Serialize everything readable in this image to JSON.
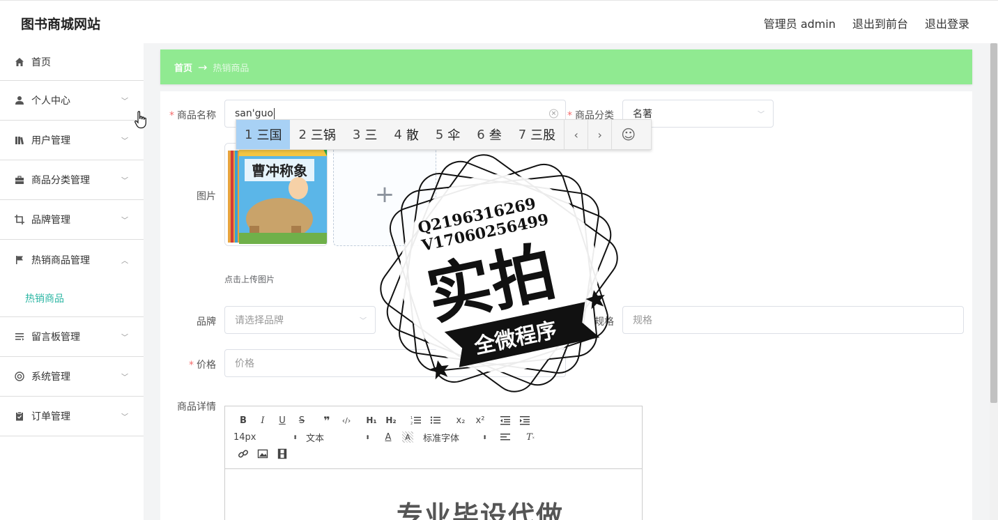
{
  "header": {
    "site_title": "图书商城网站",
    "admin_label": "管理员 admin",
    "to_front": "退出到前台",
    "logout": "退出登录"
  },
  "sidebar": {
    "items": [
      {
        "label": "首页",
        "icon": "home-icon"
      },
      {
        "label": "个人中心",
        "icon": "user-icon"
      },
      {
        "label": "用户管理",
        "icon": "books-icon"
      },
      {
        "label": "商品分类管理",
        "icon": "briefcase-icon"
      },
      {
        "label": "品牌管理",
        "icon": "crop-icon"
      },
      {
        "label": "热销商品管理",
        "icon": "flag-icon"
      },
      {
        "label": "留言板管理",
        "icon": "list-icon"
      },
      {
        "label": "系统管理",
        "icon": "lifebuoy-icon"
      },
      {
        "label": "订单管理",
        "icon": "clipboard-icon"
      }
    ],
    "submenu_active": "热销商品"
  },
  "breadcrumb": {
    "home": "首页",
    "arrow": "→",
    "current": "热销商品"
  },
  "form": {
    "name_label": "商品名称",
    "name_value": "san'guo",
    "category_label": "商品分类",
    "category_value": "名著",
    "image_label": "图片",
    "upload_tip": "点击上传图片",
    "upload_plus": "+",
    "brand_label": "品牌",
    "brand_placeholder": "请选择品牌",
    "spec_label": "规格",
    "spec_placeholder": "规格",
    "price_label": "价格",
    "price_placeholder": "价格",
    "detail_label": "商品详情",
    "required_mark": "*"
  },
  "ime": {
    "candidates": [
      {
        "num": "1",
        "text": "三国"
      },
      {
        "num": "2",
        "text": "三锅"
      },
      {
        "num": "3",
        "text": "三"
      },
      {
        "num": "4",
        "text": "散"
      },
      {
        "num": "5",
        "text": "伞"
      },
      {
        "num": "6",
        "text": "叁"
      },
      {
        "num": "7",
        "text": "三股"
      }
    ],
    "prev": "‹",
    "next": "›",
    "emoji": "☺"
  },
  "editor": {
    "font_size": "14px",
    "block_format": "文本",
    "font_family": "标准字体",
    "content_preview": "专业毕设代做"
  },
  "book": {
    "title": "曹冲称象"
  },
  "stamp": {
    "line1": "Q2196316269",
    "line2": "V17060256499",
    "main": "实拍",
    "banner": "全微程序"
  },
  "colors": {
    "breadcrumb_bg": "#90ea91",
    "accent": "#2bb6a3",
    "required": "#f56c6c",
    "ime_selected": "#a8d1f5"
  }
}
